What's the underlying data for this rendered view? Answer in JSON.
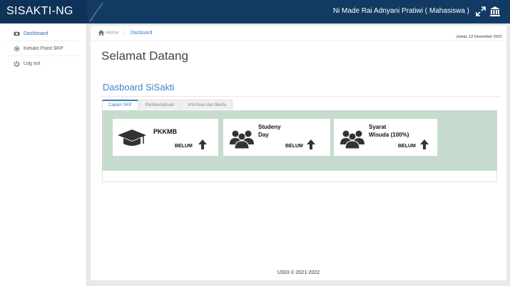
{
  "app": {
    "brand": "SISAKTI-NG",
    "user": "Ni Made Rai Adnyani Pratiwi ( Mahasiswa )"
  },
  "sidebar": {
    "items": [
      {
        "label": "Dashboard",
        "icon": "dashboard-icon",
        "active": true
      },
      {
        "label": "Ketuko Point SKP",
        "icon": "gear-icon",
        "active": false
      },
      {
        "label": "Log out",
        "icon": "power-icon",
        "active": false
      }
    ]
  },
  "breadcrumb": {
    "home": "Home",
    "current": "Dasboard"
  },
  "date": "Jumat, 12 Desember 2021",
  "main": {
    "welcome": "Selamat Datang",
    "section_title": "Dasboard SiSakti"
  },
  "tabs": [
    {
      "label": "Capain SKP",
      "active": true
    },
    {
      "label": "Pemberitahuan",
      "active": false
    },
    {
      "label": "Informasi dan Berita",
      "active": false
    }
  ],
  "cards": [
    {
      "title": "PKKMB",
      "status": "BELUM",
      "icon": "graduation-cap-icon"
    },
    {
      "title_line1": "Studeny",
      "title_line2": "Day",
      "status": "BELUM",
      "icon": "users-group-icon"
    },
    {
      "title_line1": "Syarat",
      "title_line2": "Wisuda (100%)",
      "status": "BELUM",
      "icon": "users-group-icon"
    }
  ],
  "footer": "USDI © 2021-2022",
  "colors": {
    "topbar": "#123a62",
    "accent": "#3a86c8",
    "panel": "#c7dccf"
  }
}
